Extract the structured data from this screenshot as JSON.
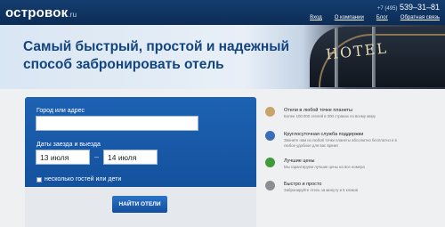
{
  "header": {
    "logo": "островок",
    "logo_suffix": ".ru",
    "phone_code": "+7 (495)",
    "phone": "539–31–81",
    "nav": [
      "Вход",
      "О компании",
      "Блог",
      "Обратная связь"
    ]
  },
  "hero": {
    "title": "Самый быстрый, простой и надежный способ забронировать отель",
    "sign_text": "HOTEL"
  },
  "search": {
    "city_label": "Город или адрес",
    "city_value": "",
    "dates_label": "Даты заезда и выезда",
    "checkin": "13 июля",
    "checkout": "14 июля",
    "dash": "–",
    "guests_label": "несколько гостей или дети",
    "button": "НАЙТИ ОТЕЛИ"
  },
  "features": [
    {
      "icon": "globe-icon",
      "title": "Отели в любой точке планеты",
      "desc": "Более 100 000 отелей в 200 странах по всему миру",
      "color": "#c9a36a"
    },
    {
      "icon": "support-icon",
      "title": "Круглосуточная служба поддержки",
      "desc": "Звоните нам из любой точки планеты абсолютно бесплатно и в любое удобное для вас время",
      "color": "#3b6fb5"
    },
    {
      "icon": "price-icon",
      "title": "Лучшие цены",
      "desc": "Мы гарантируем лучшие цены на все номера",
      "color": "#3f9a3a"
    },
    {
      "icon": "stopwatch-icon",
      "title": "Быстро и просто",
      "desc": "Забронируйте отель за минуту и 5 кликов",
      "color": "#8a8f96"
    }
  ],
  "colors": {
    "header_bg": "#0c2c55",
    "accent": "#12457f",
    "form_bg": "#1a5aa8"
  }
}
